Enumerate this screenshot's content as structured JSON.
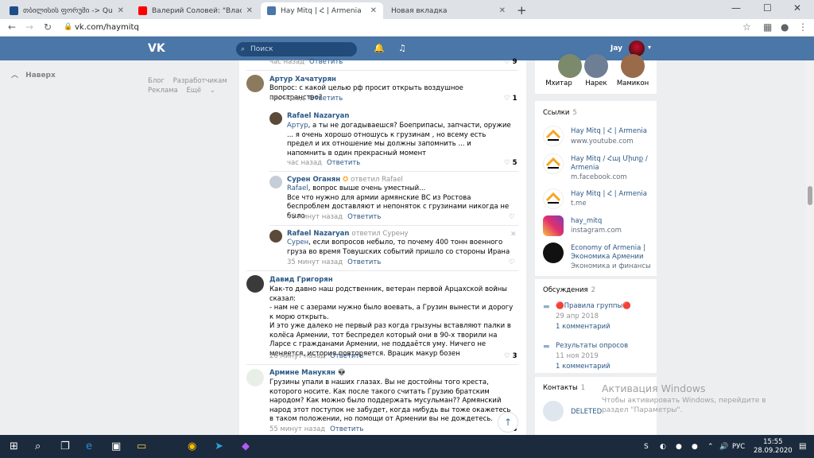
{
  "browser": {
    "tabs": [
      {
        "label": "თბილისის ფორუმი -> Quotin",
        "color": "#1d4e89"
      },
      {
        "label": "Валерий Соловей: \"Власть боит",
        "color": "#ff0000"
      },
      {
        "label": "Hay Mitq | Հ | Armenia",
        "color": "#4a76a8"
      },
      {
        "label": "Новая вкладка",
        "color": "#dee1e6"
      }
    ],
    "url": "vk.com/haymitq",
    "new_tab": "+",
    "minimize": "—",
    "maximize": "☐",
    "close": "✕"
  },
  "vk_header": {
    "logo": "VK",
    "search_placeholder": "Поиск",
    "user_name": "Jay"
  },
  "left": {
    "back": "Наверх",
    "footer_links": [
      "Блог",
      "Разработчикам",
      "Реклама",
      "Ещё"
    ]
  },
  "comments": [
    {
      "meta_time": "час назад",
      "answer": "Ответить",
      "likes": "9"
    },
    {
      "author": "Артур Хачатурян",
      "text": "Вопрос: с какой целью рф просит открыть воздушное пространство?",
      "time": "час назад",
      "answer": "Ответить",
      "likes": "1"
    },
    {
      "author": "Rafael Nazaryan",
      "mention": "Артур",
      "text": ", а ты не догадываешся? Боеприпасы, запчасти, оружие ... я очень хорошо отношусь к грузинам , но всему есть предел и их отношение мы должны запомнить ... и напомнить в один прекрасный момент",
      "time": "час назад",
      "answer": "Ответить",
      "likes": "5"
    },
    {
      "author": "Сурен Оганян",
      "reply_to": "ответил Rafael",
      "mention": "Rafael",
      "text": ", вопрос выше очень уместный...\nВсе что нужно для армии армянские ВС из Ростова беспроблем доставляют и непоняток с грузинами никогда не было",
      "time": "46 минут назад",
      "answer": "Ответить",
      "likes": ""
    },
    {
      "author": "Rafael Nazaryan",
      "reply_to": "ответил Сурену",
      "mention": "Сурен",
      "text": ", если вопросов небыло, то почему 400 тонн военного груза во время Товушских событий пришло со стороны Ирана",
      "time": "35 минут назад",
      "answer": "Ответить",
      "likes": ""
    },
    {
      "author": "Давид Григорян",
      "text": "Как-то давно наш родственник, ветеран первой Арцахской войны сказал:\n- нам не с азерами нужно было воевать, а Грузин вынести и дорогу к морю открыть.\nИ это уже далеко не первый раз когда грызуны вставляют палки в колёса Армении, тот беспредел который они в 90-х творили на Ларсе с гражданами Армении, не поддаётся уму. Ничего не меняется, история повторяется. Врацик макур бозен",
      "time": "26 минут назад",
      "answer": "Ответить",
      "likes": "3"
    },
    {
      "author": "Армине Манукян",
      "text": "Грузины упали в наших глазах. Вы не достойны того креста, которого носите. Как после такого считать Грузию братским народом? Как можно было поддержать мусульман?? Армянский народ этот поступок не забудет, когда нибудь вы тоже окажетесь в таком положении, но помощи от Армении вы не дождетесь.",
      "time": "55 минут назад",
      "answer": "Ответить",
      "likes": "3"
    }
  ],
  "friends": [
    {
      "name": "Мхитар"
    },
    {
      "name": "Нарек"
    },
    {
      "name": "Мамикон"
    }
  ],
  "links": {
    "title": "Ссылки",
    "count": "5",
    "items": [
      {
        "name": "Hay Mitq | Հ | Armenia",
        "url": "www.youtube.com"
      },
      {
        "name": "Hay Mitq / Հայ Միտք / Armenia",
        "url": "m.facebook.com"
      },
      {
        "name": "Hay Mitq | Հ | Armenia",
        "url": "t.me"
      },
      {
        "name": "hay_mitq",
        "url": "instagram.com"
      },
      {
        "name": "Economy of Armenia | Экономика Армении",
        "url": "Экономика и финансы"
      }
    ]
  },
  "discussions": {
    "title": "Обсуждения",
    "count": "2",
    "items": [
      {
        "name": "🔴Правила группы🔴",
        "date": "29 апр 2018",
        "comments": "1 комментарий"
      },
      {
        "name": "Результаты опросов",
        "date": "11 ноя 2019",
        "comments": "1 комментарий"
      }
    ]
  },
  "contacts": {
    "title": "Контакты",
    "count": "1",
    "deleted": "DELETED"
  },
  "windows": {
    "activation_title": "Активация Windows",
    "activation_text": "Чтобы активировать Windows, перейдите в раздел \"Параметры\".",
    "lang": "РУС",
    "time": "15:55",
    "date": "28.09.2020"
  },
  "colors": {
    "vk_blue": "#4a76a8",
    "link": "#2a5885"
  }
}
